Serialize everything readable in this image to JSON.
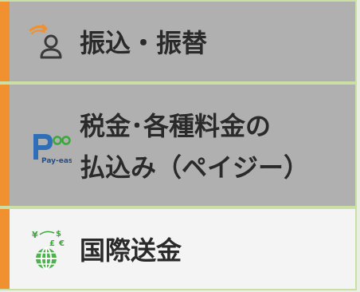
{
  "menu": {
    "items": [
      {
        "label": "振込・振替",
        "icon": "person-transfer-icon"
      },
      {
        "label_line1": "税金･各種料金の",
        "label_line2": "払込み（ペイジー）",
        "icon": "pay-easy-icon",
        "logo_text": "Pay-easy"
      },
      {
        "label": "国際送金",
        "icon": "globe-currency-icon"
      }
    ],
    "colors": {
      "accent": "#f0902f",
      "item_gray": "#b0b0b0",
      "item_light": "#f4f4f4",
      "border": "#c9dfa3",
      "text": "#2a2a2a"
    }
  }
}
